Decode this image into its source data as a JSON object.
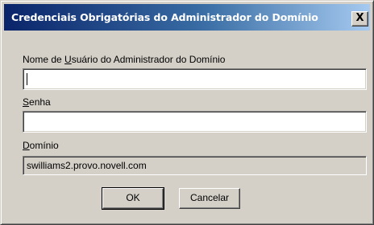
{
  "window": {
    "title": "Credenciais Obrigatórias do Administrador do Domínio",
    "close_glyph": "X",
    "close_icon": "close-icon"
  },
  "form": {
    "username": {
      "label_prefix": "Nome de ",
      "label_accel": "U",
      "label_suffix": "suário do Administrador do Domínio",
      "value": ""
    },
    "password": {
      "label_accel": "S",
      "label_suffix": "enha",
      "value": ""
    },
    "domain": {
      "label_accel": "D",
      "label_suffix": "omínio",
      "value": "swilliams2.provo.novell.com"
    }
  },
  "buttons": {
    "ok_label": "OK",
    "cancel_label": "Cancelar"
  },
  "colors": {
    "face": "#d4d0c8",
    "title_start": "#0a246a",
    "title_end": "#a6caf0"
  }
}
